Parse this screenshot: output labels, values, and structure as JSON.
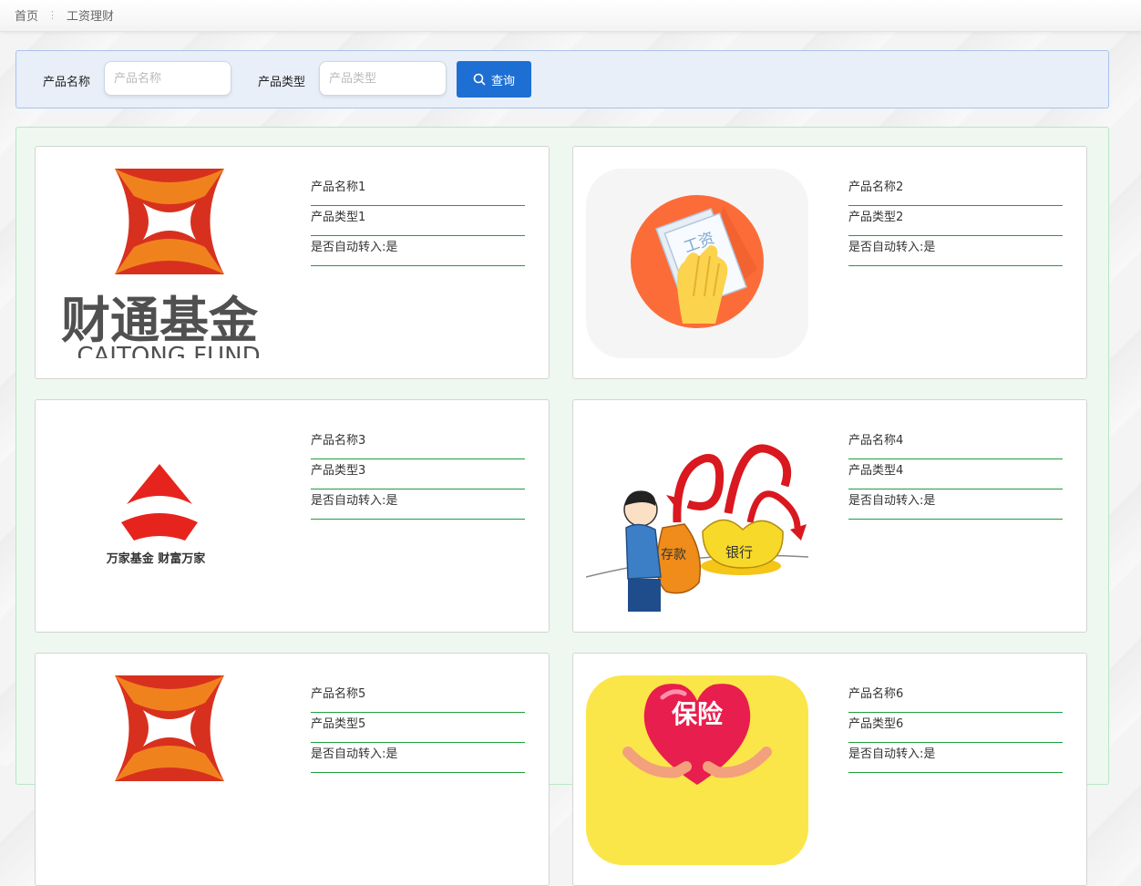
{
  "breadcrumb": {
    "home": "首页",
    "current": "工资理财"
  },
  "search": {
    "name_label": "产品名称",
    "name_placeholder": "产品名称",
    "name_value": "",
    "type_label": "产品类型",
    "type_placeholder": "产品类型",
    "type_value": "",
    "button_label": "查询",
    "button_icon": "search-icon",
    "accent": "#1e6fd4"
  },
  "products": [
    {
      "name": "产品名称1",
      "type": "产品类型1",
      "auto": "是否自动转入:是",
      "image": "caitong-fund-logo",
      "logo_cn": "财通基金",
      "logo_en": "CAITONG FUND"
    },
    {
      "name": "产品名称2",
      "type": "产品类型2",
      "auto": "是否自动转入:是",
      "image": "salary-icon",
      "logo_cn": "工资"
    },
    {
      "name": "产品名称3",
      "type": "产品类型3",
      "auto": "是否自动转入:是",
      "image": "wanjia-fund-logo",
      "logo_cn": "万家基金 财富万家"
    },
    {
      "name": "产品名称4",
      "type": "产品类型4",
      "auto": "是否自动转入:是",
      "image": "deposit-bank-cartoon",
      "bag_text": "存款",
      "gold_text": "银行"
    },
    {
      "name": "产品名称5",
      "type": "产品类型5",
      "auto": "是否自动转入:是",
      "image": "caitong-fund-logo"
    },
    {
      "name": "产品名称6",
      "type": "产品类型6",
      "auto": "是否自动转入:是",
      "image": "insurance-heart-icon",
      "logo_cn": "保险"
    }
  ]
}
